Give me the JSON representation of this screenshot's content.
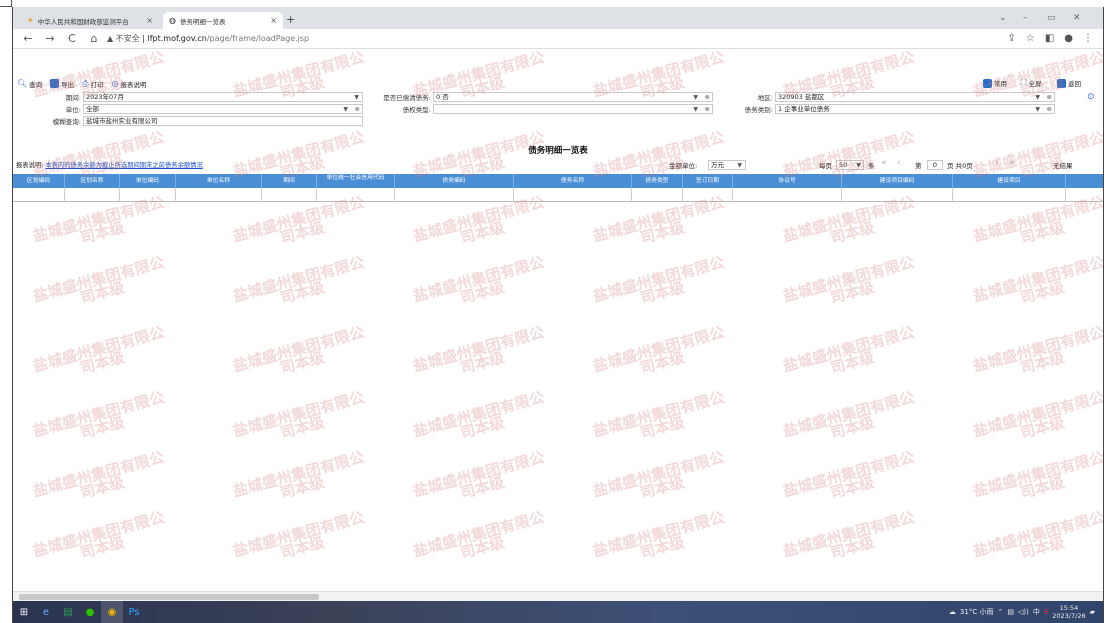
{
  "browser": {
    "tabs": [
      {
        "title": "中华人民共和国财政部监测平台",
        "active": false
      },
      {
        "title": "债务明细一览表",
        "active": true
      }
    ],
    "url_warning": "不安全",
    "url_host": "lfpt.mof.gov.cn",
    "url_path": "/page/frame/loadPage.jsp"
  },
  "toolbar": {
    "query": "查询",
    "export": "导出",
    "print": "打印",
    "report_desc": "报表说明",
    "common": "常用",
    "fullscreen": "全屏",
    "back": "返回"
  },
  "filters": {
    "period_label": "期间:",
    "period_value": "2023年07月",
    "repaid_label": "是否已偿清债务:",
    "repaid_value": "0 否",
    "region_label": "地区:",
    "region_value": "320903 盐都区",
    "unit_label": "单位:",
    "unit_value": "全部",
    "right_type_label": "债权类型:",
    "right_type_value": "",
    "debt_cat_label": "债务类别:",
    "debt_cat_value": "1 企事业单位债务",
    "fuzzy_label": "模糊查询:",
    "fuzzy_value": "盐城市盐州实业有限公司"
  },
  "report": {
    "title": "债务明细一览表",
    "desc_prefix": "报表说明:",
    "desc_link": "本表内的债务余额为截止所选期间期末之前债务余额情况",
    "amount_unit_label": "金额单位:",
    "amount_unit_value": "万元",
    "per_page_label": "每页",
    "per_page_value": "50",
    "per_page_unit": "条",
    "page_label": "第",
    "page_value": "0",
    "page_total": "页 共0页",
    "no_result": "无结果"
  },
  "columns": [
    "区划编码",
    "区划名称",
    "单位编码",
    "单位名称",
    "期间",
    "单位统一社会信用代码",
    "债务编码",
    "债务名称",
    "债务类型",
    "签订日期",
    "协议号",
    "建设项目编码",
    "建设项目"
  ],
  "watermark": "盐城盛州集团有限公\n司本级",
  "taskbar": {
    "weather": "31°C 小雨",
    "ime": "中",
    "time": "15:54",
    "date": "2023/7/26"
  },
  "colors": {
    "header": "#4a8fd6",
    "link": "#1a4fc7"
  }
}
